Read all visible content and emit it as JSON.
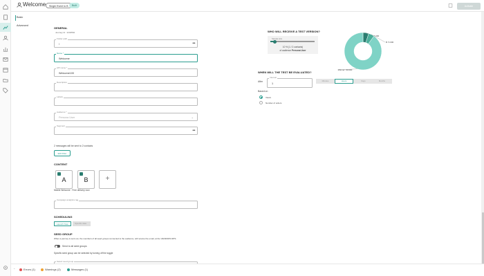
{
  "header": {
    "title": "Welcome",
    "badges": [
      "Single Event to B",
      "Built"
    ],
    "activate_label": "Activate"
  },
  "subnav": {
    "items": [
      "Basic",
      "Advanced"
    ]
  },
  "general": {
    "heading": "GENERAL",
    "journey_id": "Journey Id : 1234562",
    "folder_path": {
      "label": "Folder path",
      "value": "/"
    },
    "name": {
      "label": "Name *",
      "value": "Welcome"
    },
    "api_name": {
      "label": "API name *",
      "value": "Welcome100"
    },
    "description": {
      "label": "Description",
      "value": ""
    },
    "labels": {
      "label": "Labels",
      "value": ""
    },
    "audience": {
      "label": "Audience *",
      "value": "Persona User"
    },
    "segment": {
      "label": "Segment",
      "value": ""
    },
    "messages_note": "2 messages will be sent to 2 contacts",
    "edit_filter_label": "Edit Filter"
  },
  "content": {
    "heading": "CONTENT",
    "variants": [
      "A",
      "B"
    ],
    "footer_note": "Mobile Welcome · Free delivery now",
    "campaign_tag": {
      "label": "Campaign analytics tag",
      "value": ""
    }
  },
  "scheduling": {
    "heading": "SCHEDULING",
    "options": [
      "Launch Now",
      "Specific date"
    ]
  },
  "seed_group": {
    "heading": "SEED GROUP",
    "description": "When a journey is sent out, the members of all seed groups connected to the audience, will receive the email, at the VENDORS RPS.",
    "toggle_label": "Send to all seed groups",
    "note": "Specific seed group can be selected by turning off the toggle",
    "select_label": "Select seed group"
  },
  "test_version": {
    "heading": "WHO WILL RECEIVE A TEST VERSION?",
    "slider_label": "Sample size",
    "percent_text": "10 % (1 / 2 contacts)",
    "audience_text_prefix": "of audience",
    "audience_name": "Persona User",
    "test_percent": 10
  },
  "chart_data": {
    "type": "pie",
    "labels": [
      "A: 5.000",
      "B: 5.000",
      "Winner: 90.000"
    ],
    "values": [
      5,
      5,
      90
    ],
    "colors": [
      "#2a7d70",
      "#4caf9b",
      "#7fd3c6"
    ]
  },
  "evaluation": {
    "heading": "WHEN WILL THE TEST BE EVALUATED?",
    "after_label": "After",
    "interval_label": "Interval",
    "interval_value": "1",
    "units": [
      "Minutes",
      "Hours",
      "Days",
      "Months"
    ],
    "selected_unit": "Hours",
    "based_on_label": "Based on",
    "based_on_options": [
      "Views",
      "Number of orders"
    ],
    "based_on_selected": "Views"
  },
  "footer": {
    "errors": "Errors (1)",
    "warnings": "Warnings (2)",
    "messages": "Messages (1)",
    "error_color": "#e05252",
    "warning_color": "#f0a030",
    "message_color": "#2a9d8f"
  },
  "icons": [
    "home-icon",
    "document-icon",
    "journey-icon",
    "contacts-icon",
    "chart-icon",
    "mail-icon",
    "calendar-icon",
    "folder-icon",
    "tag-icon",
    "settings-icon",
    "user-icon",
    "more-icon",
    "chevron-down-icon"
  ]
}
